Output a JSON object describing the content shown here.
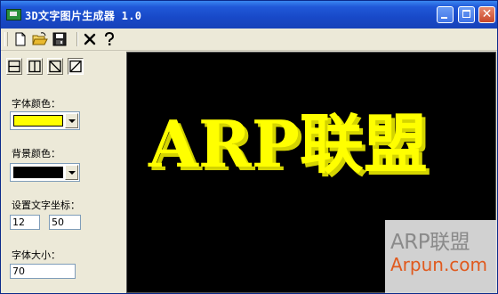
{
  "window": {
    "title": "3D文字图片生成器 1.0"
  },
  "toolbar": {
    "items": [
      {
        "name": "new-file-icon"
      },
      {
        "name": "open-folder-icon"
      },
      {
        "name": "save-icon"
      },
      {
        "name": "delete-icon"
      },
      {
        "name": "help-icon"
      }
    ]
  },
  "mode_buttons": [
    {
      "name": "horizontal-split-icon",
      "active": false
    },
    {
      "name": "vertical-split-icon",
      "active": false
    },
    {
      "name": "diagonal-down-icon",
      "active": false
    },
    {
      "name": "diagonal-up-icon",
      "active": true
    }
  ],
  "form": {
    "font_color_label": "字体颜色：",
    "font_color": "#ffff00",
    "bg_color_label": "背景颜色：",
    "bg_color": "#000000",
    "coords_label": "设置文字坐标：",
    "x_value": "12",
    "y_value": "50",
    "font_size_label": "字体大小：",
    "font_size_value": "70"
  },
  "canvas": {
    "text": "ARP联盟",
    "text_color": "#ffff00",
    "shadow_color": "#d4d400",
    "background": "#000000"
  },
  "watermark": {
    "line1": "ARP联盟",
    "line2": "Arpun.com"
  }
}
